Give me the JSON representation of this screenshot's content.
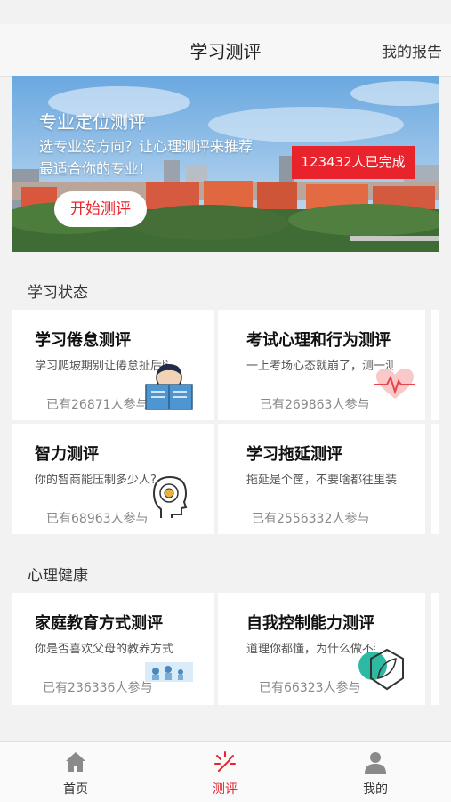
{
  "header": {
    "title": "学习测评",
    "right_link": "我的报告"
  },
  "banner": {
    "title": "专业定位测评",
    "subtitle_line1": "选专业没方向？让心理测评来推荐",
    "subtitle_line2": "最适合你的专业!",
    "badge": "123432人已完成",
    "start_button": "开始测评"
  },
  "sections": {
    "study": {
      "label": "学习状态",
      "cards": [
        {
          "title": "学习倦怠测评",
          "desc": "学习爬坡期别让倦怠扯后腿",
          "count": "已有26871人参与",
          "icon": "reading-boy-icon"
        },
        {
          "title": "考试心理和行为测评",
          "desc": "一上考场心态就崩了，测一测",
          "count": "已有269863人参与",
          "icon": "heartbeat-icon"
        },
        {
          "title": "智力测评",
          "desc": "你的智商能压制多少人?",
          "count": "已有68963人参与",
          "icon": "brain-head-icon"
        },
        {
          "title": "学习拖延测评",
          "desc": "拖延是个筐，不要啥都往里装",
          "count": "已有2556332人参与",
          "icon": ""
        }
      ]
    },
    "mental": {
      "label": "心理健康",
      "cards": [
        {
          "title": "家庭教育方式测评",
          "desc": "你是否喜欢父母的教养方式",
          "count": "已有236336人参与",
          "icon": "family-photo-icon"
        },
        {
          "title": "自我控制能力测评",
          "desc": "道理你都懂，为什么做不到",
          "count": "已有66323人参与",
          "icon": "hexagon-leaf-icon"
        }
      ]
    }
  },
  "tabbar": {
    "items": [
      {
        "label": "首页",
        "icon": "home-icon"
      },
      {
        "label": "测评",
        "icon": "sparkle-icon",
        "active": true
      },
      {
        "label": "我的",
        "icon": "user-icon"
      }
    ],
    "active_color": "#e8232b"
  }
}
